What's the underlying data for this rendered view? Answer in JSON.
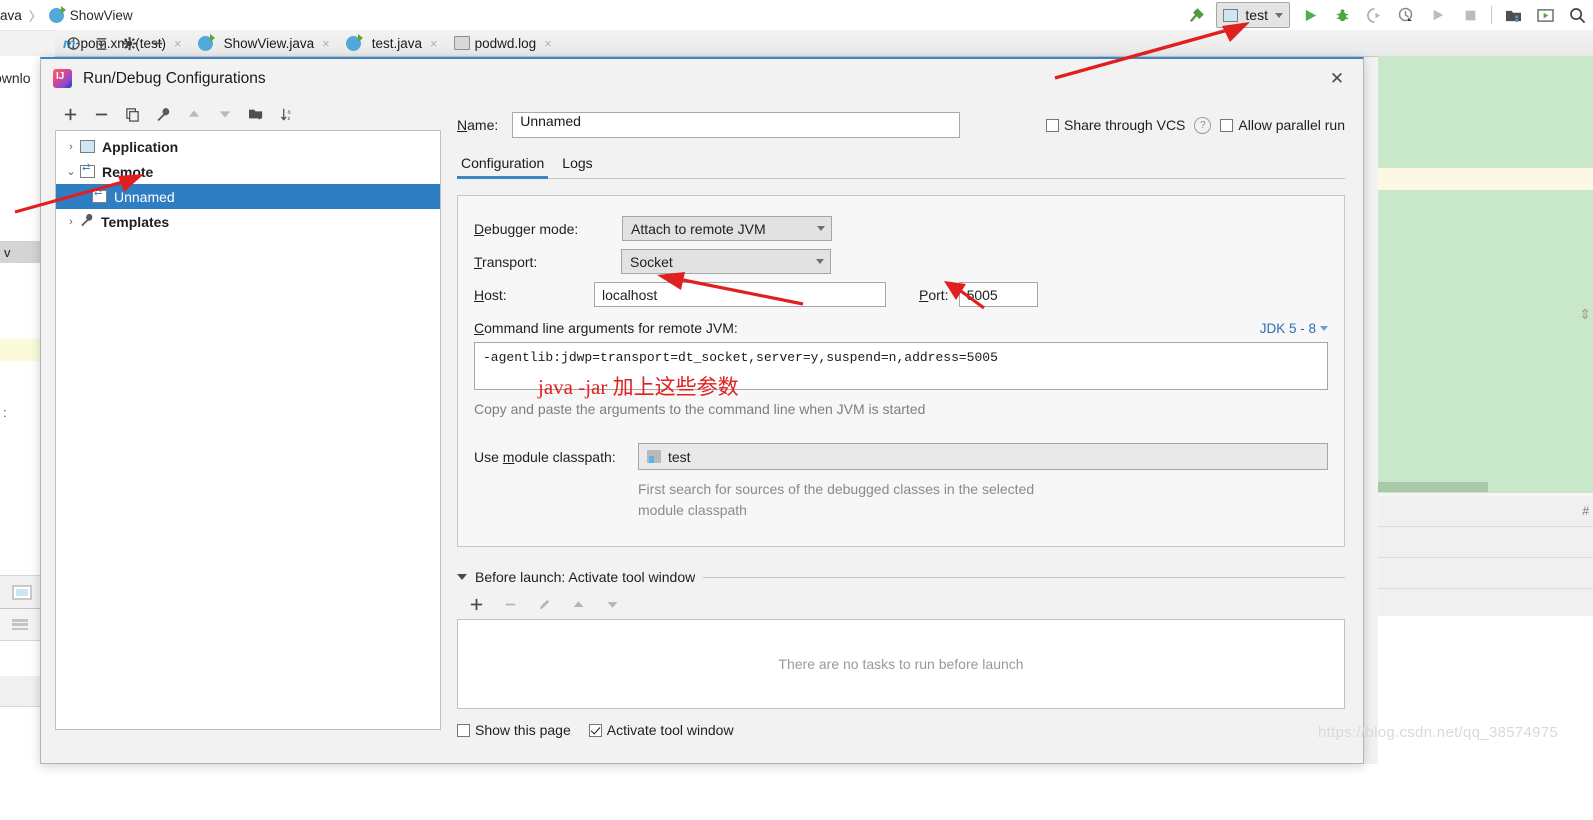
{
  "ide": {
    "breadcrumb": {
      "parent": "ava",
      "separator": "〉",
      "current": "ShowView",
      "icon": "java-class-icon"
    },
    "editor_tabs": [
      {
        "label": "pom.xml (test)",
        "icon": "maven-icon",
        "close": "×"
      },
      {
        "label": "ShowView.java",
        "icon": "java-class-icon",
        "close": "×"
      },
      {
        "label": "test.java",
        "icon": "java-class-icon",
        "close": "×"
      },
      {
        "label": "podwd.log",
        "icon": "log-file-icon",
        "close": "×"
      }
    ],
    "project_tools": [
      "locate-icon",
      "collapse-all-icon",
      "settings-gear-icon",
      "hide-icon"
    ],
    "toolbar": {
      "build_icon": "hammer-build-icon",
      "run_config": {
        "label": "test",
        "icon": "module-icon",
        "chevron": "▾"
      },
      "buttons": [
        {
          "icon": "run-icon",
          "glyph": "▶",
          "color": "#4caf50"
        },
        {
          "icon": "debug-bug-icon",
          "glyph": "☢",
          "color": "#4caf50"
        },
        {
          "icon": "run-with-coverage-icon",
          "glyph": "▷",
          "color": "#b0b0b0"
        },
        {
          "icon": "profiler-icon",
          "glyph": "◴",
          "color": "#8a8a8a"
        },
        {
          "icon": "rerun-icon",
          "glyph": "▶",
          "color": "#b9b9b9"
        },
        {
          "icon": "stop-icon",
          "glyph": "■",
          "color": "#b9b9b9"
        },
        {
          "icon": "project-structure-icon",
          "glyph": "▣",
          "color": "#5a5a5a"
        },
        {
          "icon": "terminal-icon",
          "glyph": "▣",
          "color": "#5a8f3d"
        },
        {
          "icon": "search-icon",
          "glyph": "⌕",
          "color": "#3a3a3a"
        }
      ]
    },
    "background_left": {
      "text": "ownlo",
      "gray_row": "v"
    },
    "watermark": "https://blog.csdn.net/qq_38574975"
  },
  "dialog": {
    "title": "Run/Debug Configurations",
    "logo": "intellij-idea-logo",
    "close_label": "✕",
    "left_toolbar": [
      {
        "name": "add-configuration-button",
        "glyph": "＋"
      },
      {
        "name": "remove-configuration-button",
        "glyph": "－"
      },
      {
        "name": "copy-configuration-button",
        "glyph": "❐"
      },
      {
        "name": "edit-templates-button",
        "glyph": "🔧"
      },
      {
        "name": "move-up-button",
        "glyph": "▲"
      },
      {
        "name": "move-down-button",
        "glyph": "▼"
      },
      {
        "name": "new-folder-button",
        "glyph": "📁"
      },
      {
        "name": "sort-alphabetically-button",
        "glyph": "↓ᴀᴢ"
      }
    ],
    "tree": [
      {
        "label": "Application",
        "arrow": "›",
        "icon": "application-icon",
        "selected": false,
        "indent": 0
      },
      {
        "label": "Remote",
        "arrow": "⌄",
        "icon": "remote-icon",
        "selected": false,
        "indent": 0
      },
      {
        "label": "Unnamed",
        "arrow": "",
        "icon": "remote-icon",
        "selected": true,
        "indent": 1
      },
      {
        "label": "Templates",
        "arrow": "›",
        "icon": "wrench-icon",
        "selected": false,
        "indent": 0
      }
    ],
    "name": {
      "label": "Name:",
      "value": "Unnamed"
    },
    "share_vcs": {
      "label": "Share through VCS",
      "checked": false,
      "help": "?"
    },
    "allow_parallel": {
      "label": "Allow parallel run",
      "checked": false
    },
    "tabs": [
      {
        "label": "Configuration",
        "active": true
      },
      {
        "label": "Logs",
        "active": false
      }
    ],
    "config": {
      "debugger_mode": {
        "label": "Debugger mode:",
        "value": "Attach to remote JVM"
      },
      "transport": {
        "label": "Transport:",
        "value": "Socket"
      },
      "host": {
        "label": "Host:",
        "value": "localhost"
      },
      "port": {
        "label": "Port:",
        "value": "5005"
      },
      "cmd_label": "Command line arguments for remote JVM:",
      "jdk_link": "JDK 5 - 8",
      "cmd_value": "-agentlib:jdwp=transport=dt_socket,server=y,suspend=n,address=5005",
      "cmd_hint": "Copy and paste the arguments to the command line when JVM is started",
      "module_label": "Use module classpath:",
      "module_value": "test",
      "module_hint_line1": "First search for sources of the debugged classes in the selected",
      "module_hint_line2": "module classpath"
    },
    "before_launch": {
      "title": "Before launch: Activate tool window",
      "toolbar": [
        {
          "name": "add-task-button",
          "glyph": "＋"
        },
        {
          "name": "remove-task-button",
          "glyph": "－"
        },
        {
          "name": "edit-task-button",
          "glyph": "✎"
        },
        {
          "name": "move-task-up-button",
          "glyph": "▲"
        },
        {
          "name": "move-task-down-button",
          "glyph": "▼"
        }
      ],
      "empty_text": "There are no tasks to run before launch"
    },
    "show_this_page": {
      "label": "Show this page",
      "checked": false
    },
    "activate_tool_window": {
      "label": "Activate tool window",
      "checked": true
    }
  },
  "annotation": {
    "red_note": "java -jar 加上这些参数",
    "color": "#e02020"
  }
}
